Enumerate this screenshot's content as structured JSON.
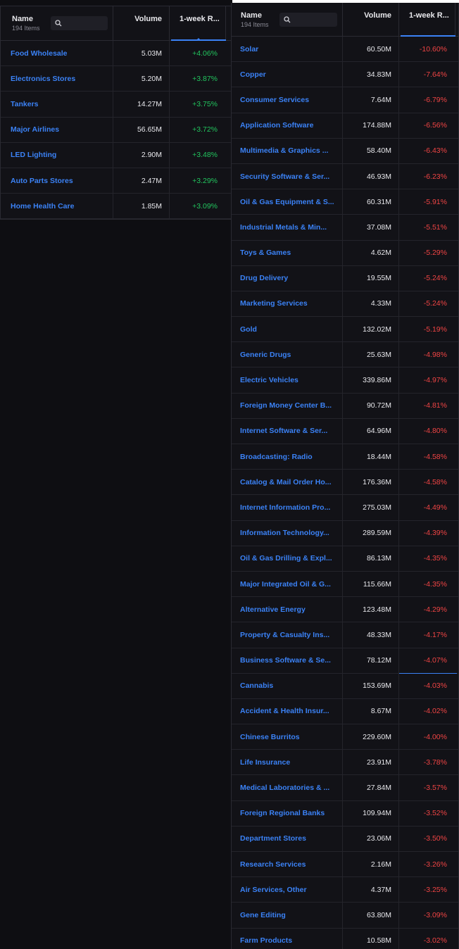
{
  "left_table": {
    "header": {
      "name": "Name",
      "count": "194 Items",
      "volume": "Volume",
      "return": "1-week R..."
    },
    "rows": [
      {
        "name": "Food Wholesale",
        "volume": "5.03M",
        "ret": "+4.06%"
      },
      {
        "name": "Electronics Stores",
        "volume": "5.20M",
        "ret": "+3.87%"
      },
      {
        "name": "Tankers",
        "volume": "14.27M",
        "ret": "+3.75%"
      },
      {
        "name": "Major Airlines",
        "volume": "56.65M",
        "ret": "+3.72%"
      },
      {
        "name": "LED Lighting",
        "volume": "2.90M",
        "ret": "+3.48%"
      },
      {
        "name": "Auto Parts Stores",
        "volume": "2.47M",
        "ret": "+3.29%"
      },
      {
        "name": "Home Health Care",
        "volume": "1.85M",
        "ret": "+3.09%"
      }
    ]
  },
  "right_table": {
    "header": {
      "name": "Name",
      "count": "194 Items",
      "volume": "Volume",
      "return": "1-week R..."
    },
    "rows": [
      {
        "name": "Solar",
        "volume": "60.50M",
        "ret": "-10.60%"
      },
      {
        "name": "Copper",
        "volume": "34.83M",
        "ret": "-7.64%"
      },
      {
        "name": "Consumer Services",
        "volume": "7.64M",
        "ret": "-6.79%"
      },
      {
        "name": "Application Software",
        "volume": "174.88M",
        "ret": "-6.56%"
      },
      {
        "name": "Multimedia & Graphics ...",
        "volume": "58.40M",
        "ret": "-6.43%"
      },
      {
        "name": "Security Software & Ser...",
        "volume": "46.93M",
        "ret": "-6.23%"
      },
      {
        "name": "Oil & Gas Equipment & S...",
        "volume": "60.31M",
        "ret": "-5.91%"
      },
      {
        "name": "Industrial Metals & Min...",
        "volume": "37.08M",
        "ret": "-5.51%"
      },
      {
        "name": "Toys & Games",
        "volume": "4.62M",
        "ret": "-5.29%"
      },
      {
        "name": "Drug Delivery",
        "volume": "19.55M",
        "ret": "-5.24%"
      },
      {
        "name": "Marketing Services",
        "volume": "4.33M",
        "ret": "-5.24%"
      },
      {
        "name": "Gold",
        "volume": "132.02M",
        "ret": "-5.19%"
      },
      {
        "name": "Generic Drugs",
        "volume": "25.63M",
        "ret": "-4.98%"
      },
      {
        "name": "Electric Vehicles",
        "volume": "339.86M",
        "ret": "-4.97%"
      },
      {
        "name": "Foreign Money Center B...",
        "volume": "90.72M",
        "ret": "-4.81%"
      },
      {
        "name": "Internet Software & Ser...",
        "volume": "64.96M",
        "ret": "-4.80%"
      },
      {
        "name": "Broadcasting: Radio",
        "volume": "18.44M",
        "ret": "-4.58%"
      },
      {
        "name": "Catalog & Mail Order Ho...",
        "volume": "176.36M",
        "ret": "-4.58%"
      },
      {
        "name": "Internet Information Pro...",
        "volume": "275.03M",
        "ret": "-4.49%"
      },
      {
        "name": "Information Technology...",
        "volume": "289.59M",
        "ret": "-4.39%"
      },
      {
        "name": "Oil & Gas Drilling & Expl...",
        "volume": "86.13M",
        "ret": "-4.35%"
      },
      {
        "name": "Major Integrated Oil & G...",
        "volume": "115.66M",
        "ret": "-4.35%"
      },
      {
        "name": "Alternative Energy",
        "volume": "123.48M",
        "ret": "-4.29%"
      },
      {
        "name": "Property & Casualty Ins...",
        "volume": "48.33M",
        "ret": "-4.17%"
      },
      {
        "name": "Business Software & Se...",
        "volume": "78.12M",
        "ret": "-4.07%"
      },
      {
        "name": "Cannabis",
        "volume": "153.69M",
        "ret": "-4.03%"
      },
      {
        "name": "Accident & Health Insur...",
        "volume": "8.67M",
        "ret": "-4.02%"
      },
      {
        "name": "Chinese Burritos",
        "volume": "229.60M",
        "ret": "-4.00%"
      },
      {
        "name": "Life Insurance",
        "volume": "23.91M",
        "ret": "-3.78%"
      },
      {
        "name": "Medical Laboratories & ...",
        "volume": "27.84M",
        "ret": "-3.57%"
      },
      {
        "name": "Foreign Regional Banks",
        "volume": "109.94M",
        "ret": "-3.52%"
      },
      {
        "name": "Department Stores",
        "volume": "23.06M",
        "ret": "-3.50%"
      },
      {
        "name": "Research Services",
        "volume": "2.16M",
        "ret": "-3.26%"
      },
      {
        "name": "Air Services, Other",
        "volume": "4.37M",
        "ret": "-3.25%"
      },
      {
        "name": "Gene Editing",
        "volume": "63.80M",
        "ret": "-3.09%"
      },
      {
        "name": "Farm Products",
        "volume": "10.58M",
        "ret": "-3.02%"
      }
    ]
  },
  "colors": {
    "positive": "#22c55e",
    "negative": "#ef4444",
    "link": "#3b82f6"
  },
  "icons": {
    "search": "search-icon"
  }
}
